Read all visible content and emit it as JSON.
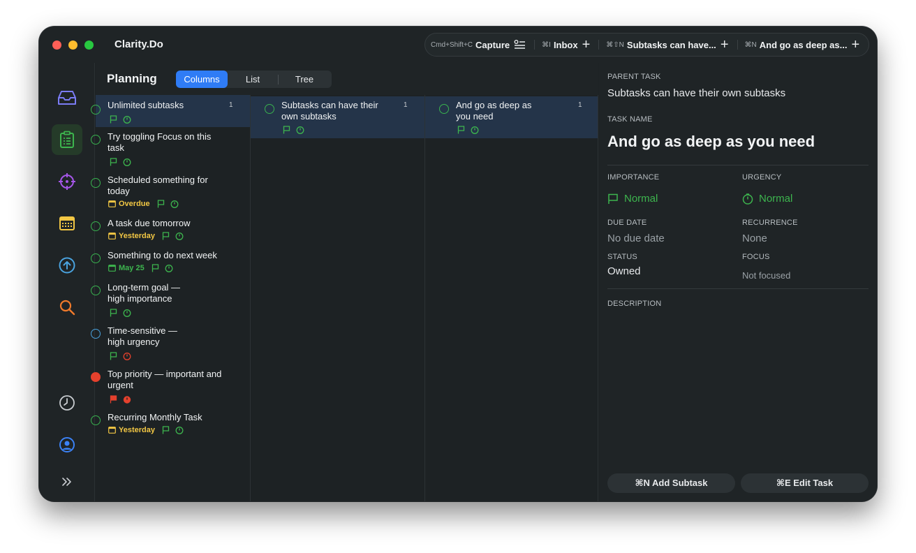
{
  "app": {
    "title": "Clarity.Do"
  },
  "tabbar": {
    "capture": {
      "shortcut": "Cmd+Shift+C",
      "label": "Capture"
    },
    "tabs": [
      {
        "shortcut": "⌘I",
        "label": "Inbox"
      },
      {
        "shortcut": "⌘⇧N",
        "label": "Subtasks can have..."
      },
      {
        "shortcut": "⌘N",
        "label": "And go as deep as..."
      }
    ]
  },
  "sidebar": {
    "items": [
      {
        "icon": "inbox-icon",
        "color": "#7b7cf5"
      },
      {
        "icon": "clipboard-list-icon",
        "color": "#3db54e",
        "active": true
      },
      {
        "icon": "crosshair-icon",
        "color": "#a556e8"
      },
      {
        "icon": "calendar-icon",
        "color": "#f2c744"
      },
      {
        "icon": "arrow-up-circle-icon",
        "color": "#4aa3df"
      },
      {
        "icon": "search-icon",
        "color": "#f07a2b"
      },
      {
        "icon": "clock-icon",
        "color": "#c8ccd0"
      },
      {
        "icon": "user-circle-icon",
        "color": "#3b82f6"
      },
      {
        "icon": "chevrons-right-icon",
        "color": "#c8ccd0"
      }
    ]
  },
  "planning": {
    "title": "Planning",
    "views": [
      "Columns",
      "List",
      "Tree"
    ],
    "active_view": "Columns"
  },
  "columns": {
    "col1": [
      {
        "title": "Unlimited subtasks",
        "count": "1",
        "selected": true
      },
      {
        "title": "Try toggling Focus on this task"
      },
      {
        "title": "Scheduled something for today",
        "date": "Overdue"
      },
      {
        "title": "A task due tomorrow",
        "date": "Yesterday"
      },
      {
        "title": "Something to do next week",
        "date": "May 25"
      },
      {
        "title": "Long-term goal — high importance"
      },
      {
        "title": "Time-sensitive — high urgency"
      },
      {
        "title": "Top priority — important and urgent"
      },
      {
        "title": "Recurring Monthly Task",
        "date": "Yesterday"
      }
    ],
    "col2": [
      {
        "title": "Subtasks can have their own subtasks",
        "count": "1",
        "selected": true
      }
    ],
    "col3": [
      {
        "title": "And go as deep as you need",
        "count": "1",
        "selected": true
      }
    ]
  },
  "colors": {
    "accent": "#2f7cf6",
    "green": "#3db54e",
    "yellow": "#f2c744",
    "red": "#e5412d",
    "blue": "#4aa3df"
  },
  "details": {
    "parent_label": "PARENT TASK",
    "parent_value": "Subtasks can have their own subtasks",
    "name_label": "TASK NAME",
    "name_value": "And go as deep as you need",
    "importance_label": "IMPORTANCE",
    "importance_value": "Normal",
    "urgency_label": "URGENCY",
    "urgency_value": "Normal",
    "due_label": "DUE DATE",
    "due_value": "No due date",
    "recurrence_label": "RECURRENCE",
    "recurrence_value": "None",
    "status_label": "STATUS",
    "status_value": "Owned",
    "focus_label": "FOCUS",
    "focus_value": "Not focused",
    "description_label": "DESCRIPTION",
    "add_subtask": "⌘N Add Subtask",
    "edit_task": "⌘E Edit Task"
  }
}
